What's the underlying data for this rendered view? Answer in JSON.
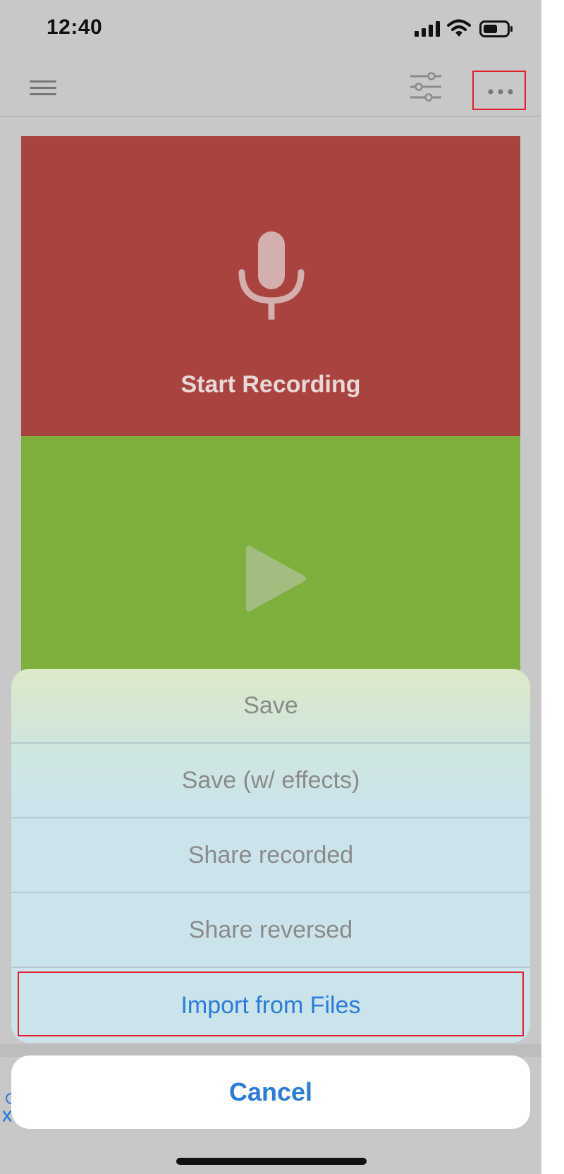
{
  "status_bar": {
    "time": "12:40",
    "icons": [
      "signal-icon",
      "wifi-icon",
      "battery-icon"
    ]
  },
  "nav_bar": {
    "icons": [
      "menu-icon",
      "sliders-icon",
      "more-horizontal-icon"
    ]
  },
  "record_panel": {
    "label": "Start Recording",
    "icon": "microphone-icon",
    "color": "#a94340"
  },
  "play_panel": {
    "icon": "play-icon",
    "color": "#7fb03d"
  },
  "action_sheet": {
    "items": [
      {
        "label": "Save"
      },
      {
        "label": "Save (w/ effects)"
      },
      {
        "label": "Share recorded"
      },
      {
        "label": "Share reversed"
      },
      {
        "label": "Import from Files"
      }
    ],
    "cancel_label": "Cancel",
    "accent_color": "#2b7bd8",
    "highlight_color": "#e0212b"
  }
}
